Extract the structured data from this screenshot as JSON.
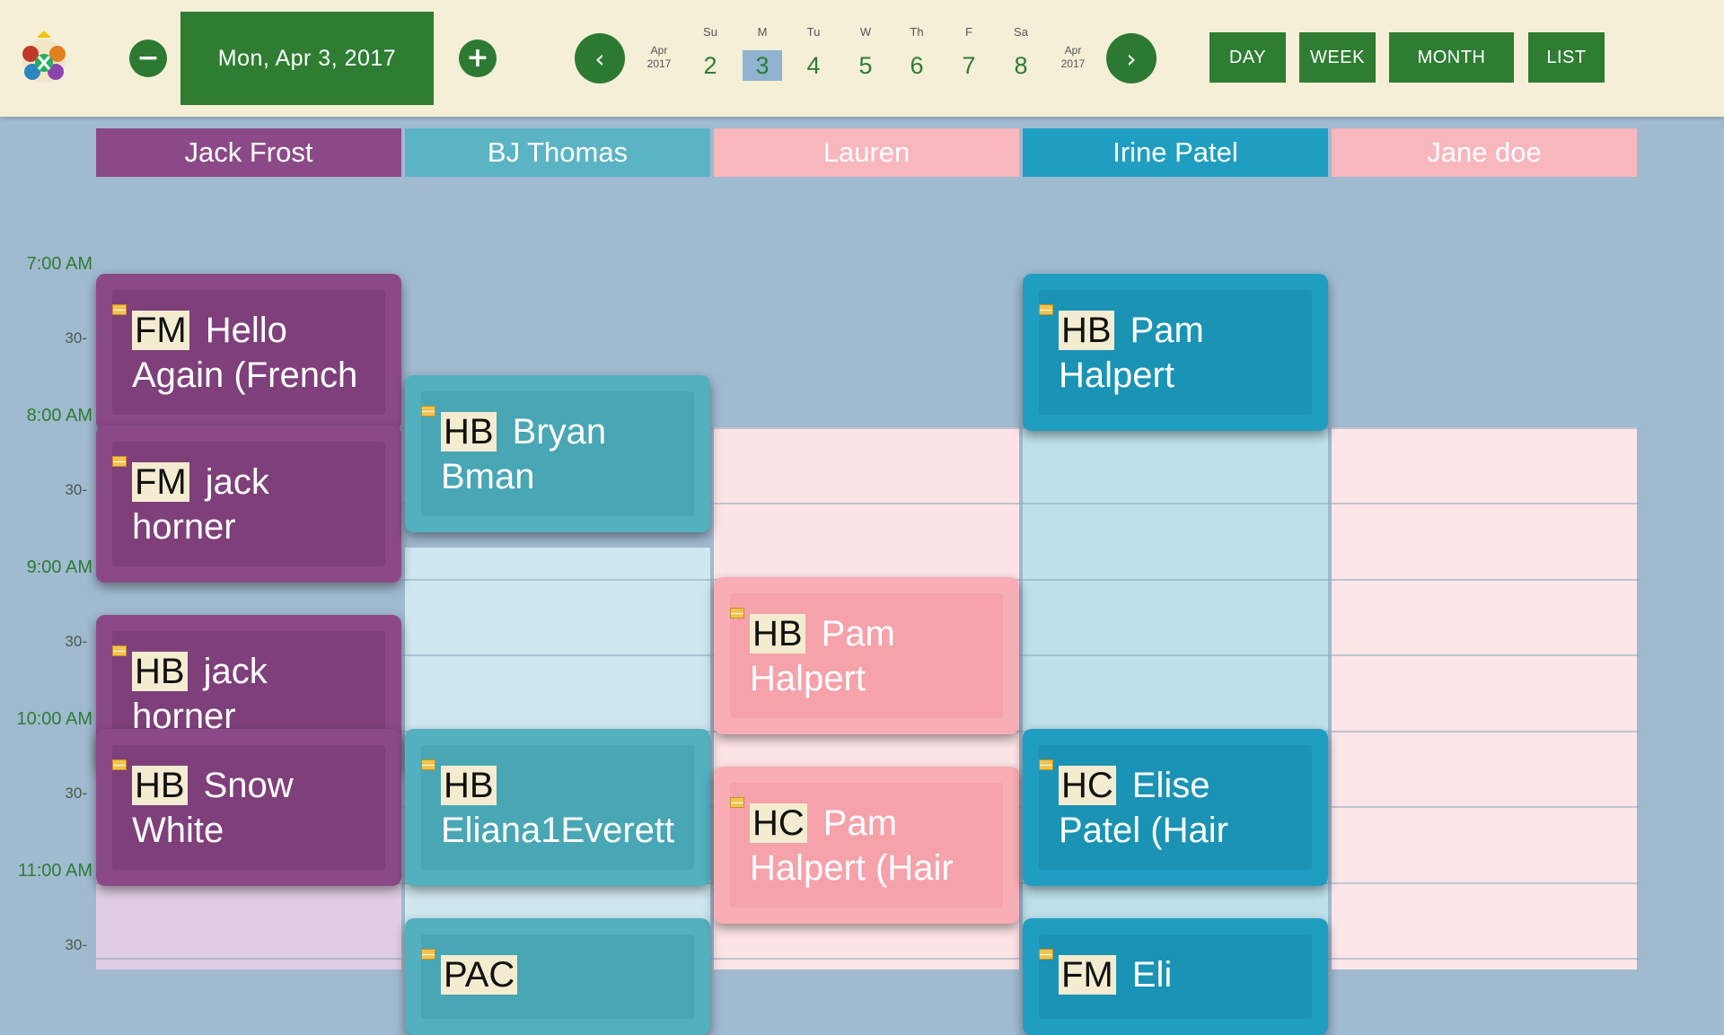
{
  "toolbar": {
    "current_date": "Mon, Apr 3, 2017",
    "prev_day_icon": "minus-circle-icon",
    "next_day_icon": "plus-circle-icon",
    "prev_week_icon": "chevron-left-icon",
    "next_week_icon": "chevron-right-icon",
    "mini_month_left": {
      "month": "Apr",
      "year": "2017"
    },
    "mini_month_right": {
      "month": "Apr",
      "year": "2017"
    },
    "week_days": [
      {
        "abbr": "Su",
        "num": "2",
        "selected": false
      },
      {
        "abbr": "M",
        "num": "3",
        "selected": true
      },
      {
        "abbr": "Tu",
        "num": "4",
        "selected": false
      },
      {
        "abbr": "W",
        "num": "5",
        "selected": false
      },
      {
        "abbr": "Th",
        "num": "6",
        "selected": false
      },
      {
        "abbr": "F",
        "num": "7",
        "selected": false
      },
      {
        "abbr": "Sa",
        "num": "8",
        "selected": false
      }
    ],
    "views": [
      "DAY",
      "WEEK",
      "MONTH",
      "LIST"
    ]
  },
  "staff": [
    {
      "name": "Jack Frost",
      "color": "#8b4a87"
    },
    {
      "name": "BJ Thomas",
      "color": "#5bb4c4"
    },
    {
      "name": "Lauren",
      "color": "#f8b7bd"
    },
    {
      "name": "Irine Patel",
      "color": "#1f9ec2"
    },
    {
      "name": "Jane doe",
      "color": "#f8b7bd"
    }
  ],
  "time_labels": [
    "7:00 AM",
    "30-",
    "8:00 AM",
    "30-",
    "9:00 AM",
    "30-",
    "10:00 AM",
    "30-",
    "11:00 AM",
    "30-"
  ],
  "events": [
    {
      "col": 0,
      "code": "FM",
      "line1": "Hello",
      "line2": "Again (French"
    },
    {
      "col": 0,
      "code": "FM",
      "line1": "jack",
      "line2": "horner"
    },
    {
      "col": 0,
      "code": "HB",
      "line1": "jack",
      "line2": "horner"
    },
    {
      "col": 0,
      "code": "HB",
      "line1": "Snow",
      "line2": "White"
    },
    {
      "col": 1,
      "code": "HB",
      "line1": "Bryan",
      "line2": "Bman"
    },
    {
      "col": 1,
      "code": "HB",
      "line1": "",
      "line2": "Eliana1Everett"
    },
    {
      "col": 1,
      "code": "PAC",
      "line1": "",
      "line2": ""
    },
    {
      "col": 2,
      "code": "HB",
      "line1": "Pam",
      "line2": "Halpert"
    },
    {
      "col": 2,
      "code": "HC",
      "line1": "Pam",
      "line2": "Halpert (Hair"
    },
    {
      "col": 3,
      "code": "HB",
      "line1": "Pam",
      "line2": "Halpert"
    },
    {
      "col": 3,
      "code": "HC",
      "line1": "Elise",
      "line2": "Patel (Hair"
    },
    {
      "col": 3,
      "code": "FM",
      "line1": "Eli",
      "line2": ""
    }
  ]
}
